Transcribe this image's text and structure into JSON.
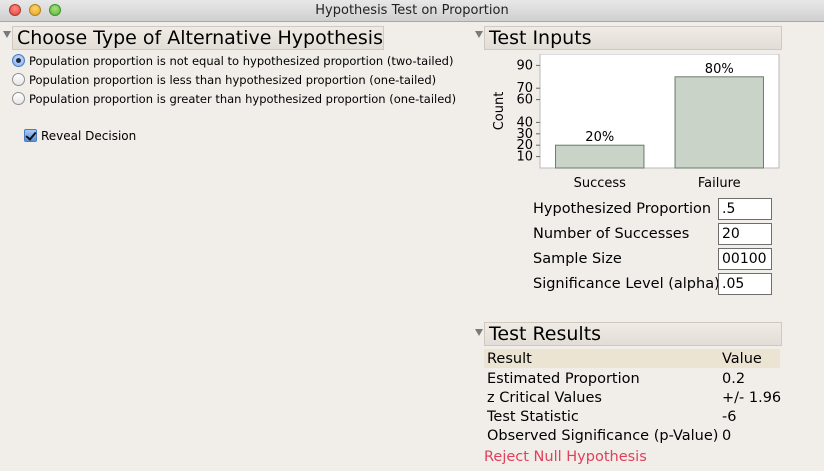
{
  "window": {
    "title": "Hypothesis Test on Proportion"
  },
  "alternative": {
    "title": "Choose Type of Alternative Hypothesis",
    "options": [
      {
        "label": "Population proportion is not equal to hypothesized proportion (two-tailed)",
        "selected": true
      },
      {
        "label": "Population proportion is less than hypothesized proportion (one-tailed)",
        "selected": false
      },
      {
        "label": "Population proportion is greater than hypothesized proportion (one-tailed)",
        "selected": false
      }
    ],
    "reveal_decision": {
      "label": "Reveal Decision",
      "checked": true
    }
  },
  "inputs": {
    "title": "Test Inputs",
    "fields": [
      {
        "label": "Hypothesized Proportion",
        "value": ".5"
      },
      {
        "label": "Number of Successes",
        "value": "20"
      },
      {
        "label": "Sample Size",
        "value": "00100"
      },
      {
        "label": "Significance Level (alpha)",
        "value": ".05"
      }
    ]
  },
  "chart_data": {
    "type": "bar",
    "categories": [
      "Success",
      "Failure"
    ],
    "values": [
      20,
      80
    ],
    "data_labels": [
      "20%",
      "80%"
    ],
    "ylabel": "Count",
    "xlabel": "",
    "yticks": [
      10,
      20,
      30,
      40,
      60,
      70,
      90
    ],
    "ylim": [
      0,
      100
    ],
    "bar_color": "#c9d3c8",
    "grid": false
  },
  "results": {
    "title": "Test Results",
    "columns": [
      "Result",
      "Value"
    ],
    "rows": [
      [
        "Estimated Proportion",
        "0.2"
      ],
      [
        "z Critical Values",
        "+/- 1.96"
      ],
      [
        "Test Statistic",
        "-6"
      ],
      [
        "Observed Significance (p-Value)",
        "0"
      ]
    ],
    "decision": "Reject Null Hypothesis",
    "decision_color": "#e0405a"
  }
}
